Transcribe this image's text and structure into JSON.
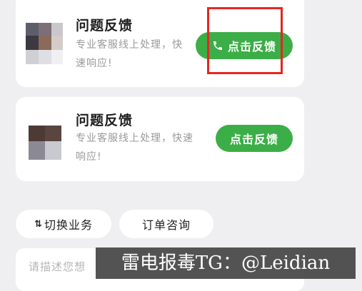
{
  "cards": [
    {
      "title": "问题反馈",
      "description_line1": "专业客服线上处理，快",
      "description_line2": "速响应!",
      "button_label": "点击反馈",
      "button_icon": "phone-icon"
    },
    {
      "title": "问题反馈",
      "description_line1": "专业客服线上处理，快速",
      "description_line2": "响应!",
      "button_label": "点击反馈"
    }
  ],
  "chips": [
    {
      "icon": "swap-icon",
      "icon_glyph": "⇅",
      "label": "切换业务"
    },
    {
      "label": "订单咨询"
    }
  ],
  "input": {
    "placeholder": "请描述您想"
  },
  "watermark": "雷电报毒TG：@Leidian",
  "colors": {
    "background": "#efeff1",
    "button_green": "#3cae47",
    "highlight_red": "#e42622"
  }
}
